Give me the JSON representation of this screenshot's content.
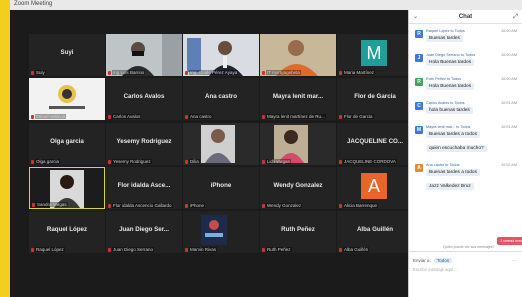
{
  "window": {
    "title": "Zoom Meeting"
  },
  "tiles": [
    {
      "label": "Suyi",
      "name": "Suiy"
    },
    {
      "label": "",
      "name": "Ing Luis Barrios"
    },
    {
      "label": "",
      "name": "Ing. Guido Pérez Ayaya"
    },
    {
      "label": "",
      "name": "IT mortgagebeta"
    },
    {
      "label": "",
      "name": "Maria Martínez",
      "avatar": "M"
    },
    {
      "label": "",
      "name": "Estuel Valdivia"
    },
    {
      "label": "Carlos Avalos",
      "name": "Carlos Avalos"
    },
    {
      "label": "Ana castro",
      "name": "Ana castro"
    },
    {
      "label": "Mayra lenit mar...",
      "name": "Mayra lenit martínez de Ru..."
    },
    {
      "label": "Flor de Garcia",
      "name": "Flor de Garcia"
    },
    {
      "label": "Olga garcia",
      "name": "Olga garcia"
    },
    {
      "label": "Yesemy Rodriguez",
      "name": "Yesemy Rodriguez"
    },
    {
      "label": "",
      "name": "Dilia"
    },
    {
      "label": "",
      "name": "Lidli vargas"
    },
    {
      "label": "JACQUELINE CO...",
      "name": "JACQUELINE CORDOVA"
    },
    {
      "label": "",
      "name": "Sandra Vargas"
    },
    {
      "label": "Flor idalda Asce...",
      "name": "Flor idalda Ascencio Gallardo"
    },
    {
      "label": "iPhone",
      "name": "iPhone"
    },
    {
      "label": "Wendy Gonzalez",
      "name": "Wendy Gonzalez"
    },
    {
      "label": "",
      "name": "Alicia Barrenque",
      "avatar": "A"
    },
    {
      "label": "Raquel López",
      "name": "Raquel López"
    },
    {
      "label": "Juan Diego Ser...",
      "name": "Juan Diego Serrano"
    },
    {
      "label": "",
      "name": "Marvin Rivas"
    },
    {
      "label": "Ruth Peñez",
      "name": "Ruth Peñez"
    },
    {
      "label": "Alba Guillén",
      "name": "Alba Guillén"
    }
  ],
  "chat": {
    "title": "Chat",
    "messages": [
      {
        "from": "Raquel López to Todos",
        "time": "10:00 AM",
        "text": "Buenas tardes",
        "color": "#3a7bd5",
        "initial": "R"
      },
      {
        "from": "Juan Diego Serrano to Todos",
        "time": "10:00 AM",
        "text": "Hola Buenas tardes",
        "color": "#3a7bd5",
        "initial": "J"
      },
      {
        "from": "Ruth Peñez to Todos",
        "time": "10:00 AM",
        "text": "Hola Buenas tardes",
        "color": "#3fa55a",
        "initial": "R"
      },
      {
        "from": "Carlos Avalos to Todos",
        "time": "10:01 AM",
        "text": "hola buenas tardes",
        "color": "#3a7bd5",
        "initial": "C"
      },
      {
        "from": "Mayra lenit mar... to Todos",
        "time": "10:01 AM",
        "text": "Buenas tardes a todos",
        "color": "#3a7bd5",
        "initial": "M"
      },
      {
        "from": "",
        "time": "",
        "text": "quien escuchaba mucho?",
        "color": "#3a7bd5",
        "initial": ""
      },
      {
        "from": "Ana castro to Todos",
        "time": "10:02 AM",
        "text": "Buenas tardes a todos",
        "color": "#e98a2e",
        "initial": "A"
      },
      {
        "from": "",
        "time": "",
        "text": "Jazz Valkedez Bruz",
        "color": "#3a7bd5",
        "initial": ""
      }
    ],
    "toast": "1 unread message",
    "hint": "Quién puede ver sus mensajes?",
    "to_label": "Enviar a:",
    "to_value": "Todos",
    "placeholder": "Escribir mensaje aquí..."
  }
}
